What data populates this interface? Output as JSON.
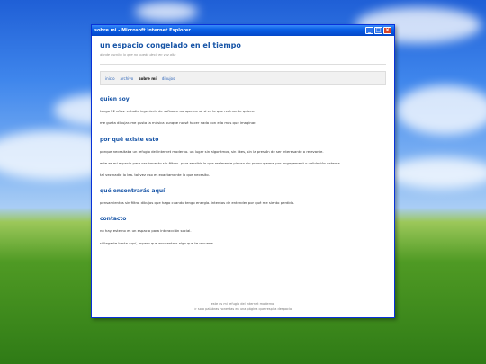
{
  "window": {
    "title": "sobre mi - Microsoft Internet Explorer",
    "controls": {
      "minimize": "_",
      "maximize": "□",
      "close": "×"
    }
  },
  "page": {
    "site_title": "un espacio congelado en el tiempo",
    "tagline": "donde escribo lo que no puedo decir en voz alta",
    "nav": [
      "inicio",
      "archivo",
      "sobre mí",
      "dibujos"
    ],
    "nav_active": "sobre mí",
    "sections": [
      {
        "heading": "quien soy",
        "paragraphs": [
          "tengo 22 años. estudio ingeniería de software aunque no sé si es lo que realmente quiero.",
          "me gusta dibujar. me gusta la música aunque no sé hacer nada con ella más que imaginar."
        ]
      },
      {
        "heading": "por qué existe esto",
        "paragraphs": [
          "porque necesitaba un refugio del internet moderno. un lugar sin algoritmos, sin likes, sin la presión de ser interesante o relevante.",
          "este es mi espacio para ser honesto sin filtros. para escribir lo que realmente pienso sin preocuparme por engagement o validación externa.",
          "tal vez nadie lo lea. tal vez eso es exactamente lo que necesito."
        ]
      },
      {
        "heading": "qué encontrarás aquí",
        "paragraphs": [
          "pensamientos sin filtro. dibujos que hago cuando tengo energía. intentos de entender por qué me siento perdido."
        ]
      },
      {
        "heading": "contacto",
        "paragraphs": [
          "no hay. este no es un espacio para interacción social.",
          "si llegaste hasta aquí, espero que encuentres algo que te resuene."
        ]
      }
    ],
    "footer": [
      "este es mi refugio del internet moderno.",
      "> solo palabras honestas en una página que respira despacio"
    ]
  }
}
